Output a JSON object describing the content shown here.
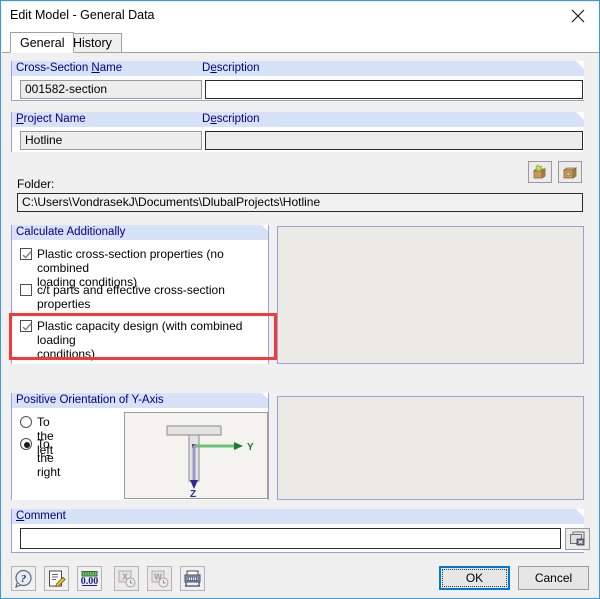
{
  "window": {
    "title": "Edit Model - General Data",
    "close_icon": "close-icon",
    "border_color": "#3c99dc"
  },
  "tabs": [
    {
      "label": "General",
      "active": true
    },
    {
      "label": "History",
      "active": false
    }
  ],
  "cross_section": {
    "name_group_label": "Cross-Section Name",
    "name_accel": "N",
    "name_value": "001582-section",
    "description_label": "Description",
    "description_accel": "e",
    "description_value": ""
  },
  "project": {
    "name_group_label": "Project Name",
    "name_accel": "P",
    "name_value": "Hotline",
    "description_label": "Description",
    "description_accel": "e",
    "description_value": ""
  },
  "folder": {
    "label": "Folder:",
    "value": "C:\\Users\\VondrasekJ\\Documents\\DlubalProjects\\Hotline",
    "new_folder_icon": "new-folder-icon",
    "browse_folder_icon": "browse-folder-icon"
  },
  "calculate_additionally": {
    "group_label": "Calculate Additionally",
    "options": [
      {
        "label_line1": "Plastic cross-section properties (no combined",
        "label_line2": "loading conditions)",
        "checked": true,
        "highlighted": false
      },
      {
        "label_line1": "c/t parts and effective cross-section properties",
        "label_line2": "",
        "checked": false,
        "highlighted": false
      },
      {
        "label_line1": "Plastic capacity design (with combined loading",
        "label_line2": "conditions)",
        "checked": true,
        "highlighted": true
      }
    ],
    "highlight_color": "#f23b36"
  },
  "y_axis_orientation": {
    "group_label": "Positive Orientation of Y-Axis",
    "options": [
      {
        "label": "To the left",
        "selected": false
      },
      {
        "label": "To the right",
        "selected": true
      }
    ],
    "diagram": {
      "y_axis_label": "Y",
      "z_axis_label": "Z",
      "y_axis_color": "#3aa34a",
      "z_axis_color": "#2b2b8f",
      "section_shape": "t-section"
    }
  },
  "comment": {
    "group_label": "Comment",
    "accel": "C",
    "value": "",
    "dropdown_icon": "chevron-down-icon",
    "pick_icon": "comment-library-icon"
  },
  "toolbar": {
    "buttons": [
      {
        "icon": "help-icon",
        "enabled": true
      },
      {
        "icon": "edit-note-icon",
        "enabled": true
      },
      {
        "icon": "units-number-icon",
        "enabled": true
      },
      {
        "icon": "export-excel-icon",
        "enabled": false
      },
      {
        "icon": "export-word-icon",
        "enabled": false
      },
      {
        "icon": "printout-report-icon",
        "enabled": true
      }
    ]
  },
  "dialog_buttons": {
    "ok": "OK",
    "cancel": "Cancel",
    "focus_color": "#0078d7"
  }
}
